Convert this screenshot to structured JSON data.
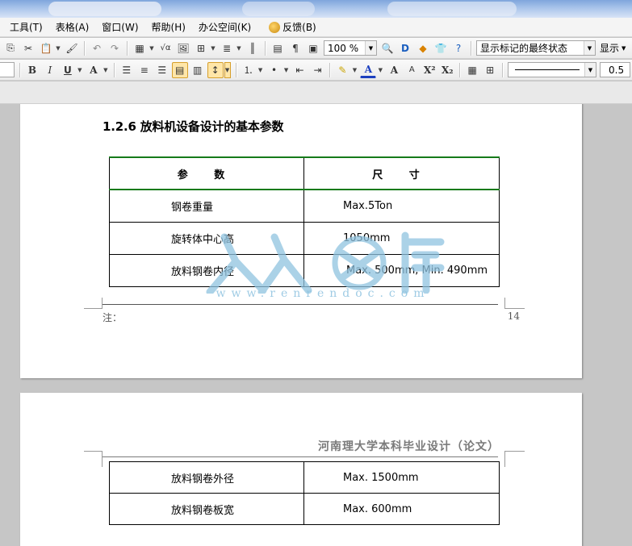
{
  "menubar": {
    "items": [
      "工具(T)",
      "表格(A)",
      "窗口(W)",
      "帮助(H)",
      "办公空间(K)",
      "反馈(B)"
    ]
  },
  "toolbar": {
    "zoom_value": "100 %",
    "markup_view": "显示标记的最终状态",
    "show_label": "显示",
    "line_width": "0.5",
    "icons": [
      "paste-icon",
      "cut-icon",
      "format-painter-icon",
      "undo-icon",
      "redo-icon",
      "insert-table-icon",
      "formula-icon",
      "columns-icon",
      "research-icon",
      "find-icon",
      "help-icon"
    ]
  },
  "formatting": {
    "bold": "B",
    "italic": "I",
    "underline": "U",
    "font_color": "A",
    "grow_font": "A",
    "shrink_font": "A",
    "superscript": "X²",
    "subscript": "X₂"
  },
  "document": {
    "page1": {
      "heading": "1.2.6 放料机设备设计的基本参数",
      "table": {
        "headers": [
          "参 数",
          "尺 寸"
        ],
        "rows": [
          [
            "钢卷重量",
            "Max.5Ton"
          ],
          [
            "旋转体中心高",
            "1050mm"
          ],
          [
            "放料钢卷内径",
            "Max. 500mm, Min. 490mm"
          ]
        ]
      },
      "footer_note": "注：",
      "page_number": "14"
    },
    "watermark": {
      "url_text": "www.renrendoc.com",
      "logo_label": "人人文库"
    },
    "page2": {
      "header_title": "河南理大学本科毕业设计（论文）",
      "table": {
        "rows": [
          [
            "放料钢卷外径",
            "Max. 1500mm"
          ],
          [
            "放料钢卷板宽",
            "Max. 600mm"
          ]
        ]
      }
    }
  },
  "colors": {
    "table_header_rule": "#157a1a",
    "watermark": "#8fc3e0",
    "workspace": "#c6c6c6"
  }
}
